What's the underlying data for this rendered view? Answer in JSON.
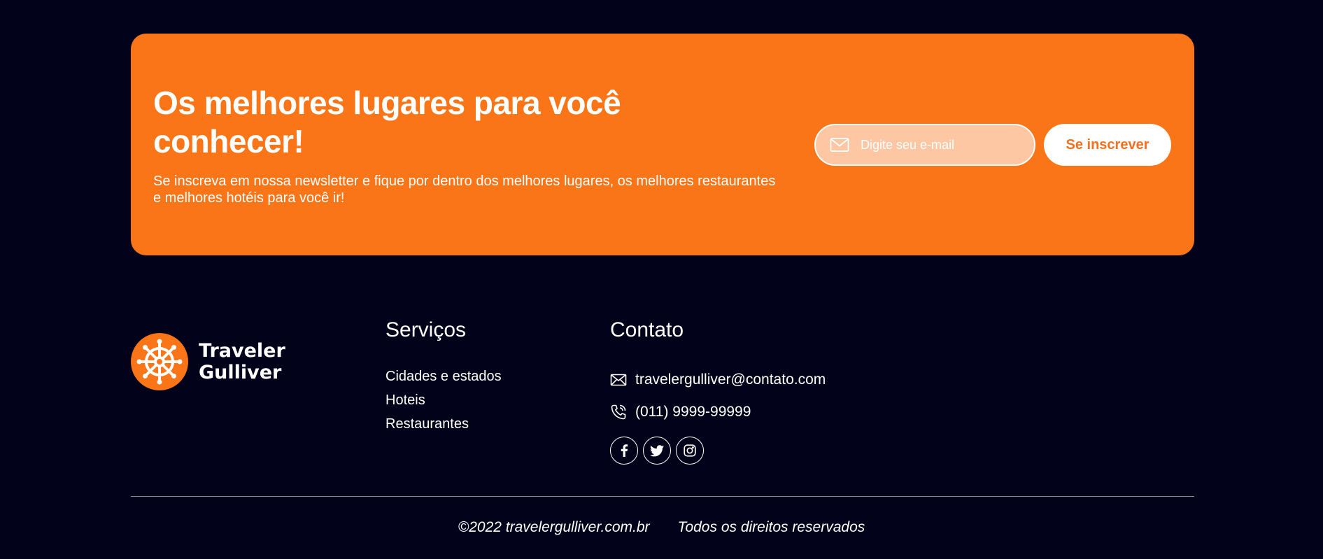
{
  "newsletter": {
    "title": "Os melhores lugares para você conhecer!",
    "subtitle": "Se inscreva em nossa newsletter e fique por dentro dos melhores lugares, os melhores restaurantes e melhores hotéis para você ir!",
    "email_placeholder": "Digite seu e-mail",
    "email_value": "",
    "email_icon": "mail-icon",
    "subscribe_label": "Se inscrever"
  },
  "brand": {
    "name_line1": "Traveler",
    "name_line2": "Gulliver",
    "logo_icon": "ship-wheel-icon"
  },
  "services": {
    "title": "Serviços",
    "items": [
      {
        "label": "Cidades e estados"
      },
      {
        "label": "Hoteis"
      },
      {
        "label": "Restaurantes"
      }
    ]
  },
  "contact": {
    "title": "Contato",
    "email": "travelergulliver@contato.com",
    "phone": "(011) 9999-99999",
    "socials": [
      "facebook-icon",
      "twitter-icon",
      "instagram-icon"
    ]
  },
  "footer": {
    "copyright": "©2022 travelergulliver.com.br",
    "rights": "Todos os direitos reservados"
  },
  "colors": {
    "background": "#02031a",
    "accent": "#fa7418",
    "input_bg": "#fec7a4"
  }
}
